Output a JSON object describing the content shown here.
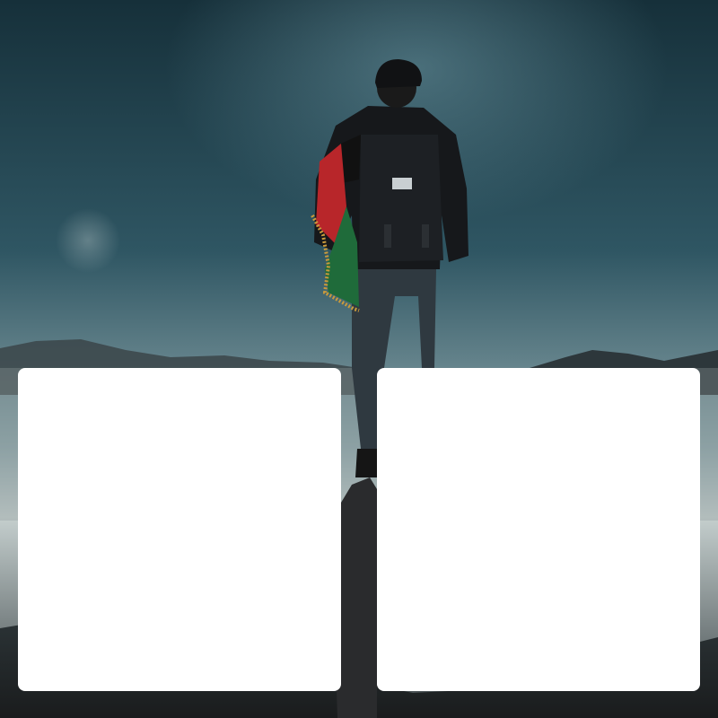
{
  "scene": {
    "subject": "hiker-with-flag",
    "colors": {
      "sky_top": "#1e3b45",
      "sky_mid": "#4a7380",
      "horizon_glow": "#b9c6c8",
      "mountains": "#2a3438",
      "rock": "#1d1d1f",
      "jacket": "#151619",
      "flag_red": "#b8262a",
      "flag_green": "#1f6b3a",
      "flag_black": "#111111",
      "fringe_gold": "#c99a3c",
      "card": "#ffffff"
    }
  },
  "cards": [
    {
      "id": "left",
      "text": ""
    },
    {
      "id": "right",
      "text": ""
    }
  ]
}
